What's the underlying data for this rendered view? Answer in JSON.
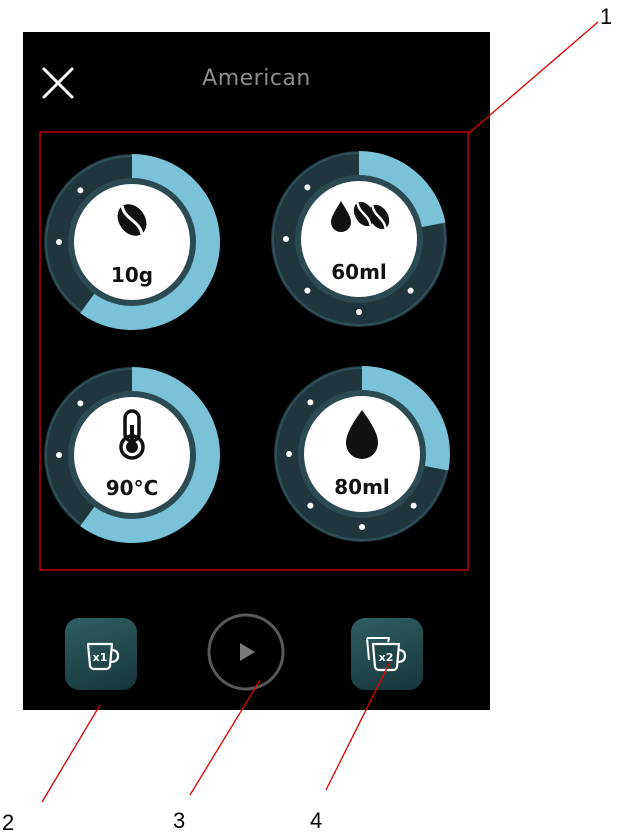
{
  "header": {
    "title": "American"
  },
  "dials": [
    {
      "label": "10g",
      "icon": "coffee-bean-icon",
      "level": 0.6
    },
    {
      "label": "60ml",
      "icon": "coffee-beans-and-drops-icon",
      "level": 0.22
    },
    {
      "label": "90°C",
      "icon": "thermometer-icon",
      "level": 0.6
    },
    {
      "label": "80ml",
      "icon": "water-drop-icon",
      "level": 0.28
    }
  ],
  "buttons": {
    "single_cup": "x1",
    "double_cup": "x2",
    "start": "play-icon"
  },
  "annotations": [
    "1",
    "2",
    "3",
    "4"
  ],
  "colors": {
    "background": "#000000",
    "ring_track": "#1f363c",
    "ring_fill": "#79c2d8",
    "ring_inner": "#2b4a52",
    "annotation": "#e00000"
  }
}
